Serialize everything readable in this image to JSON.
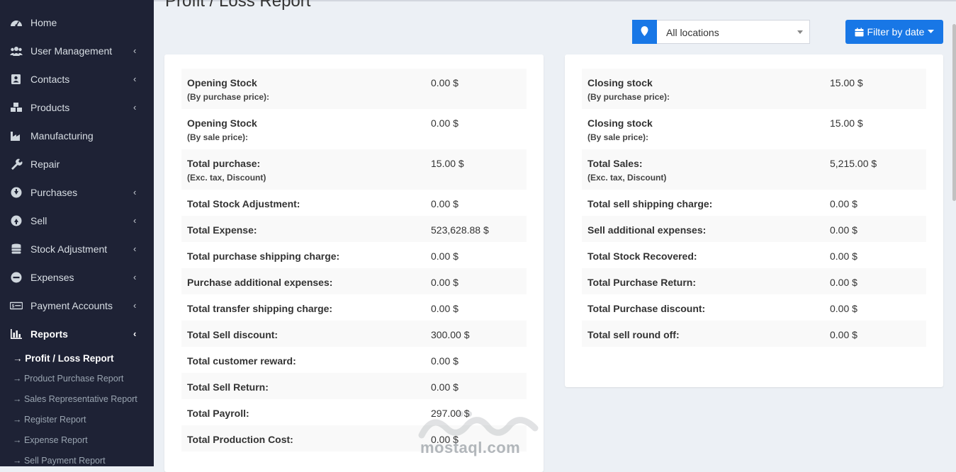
{
  "sidebar": {
    "items": [
      {
        "label": "Home",
        "icon": "dashboard-icon",
        "chevron": ""
      },
      {
        "label": "User Management",
        "icon": "users-icon",
        "chevron": "‹"
      },
      {
        "label": "Contacts",
        "icon": "address-book-icon",
        "chevron": "‹"
      },
      {
        "label": "Products",
        "icon": "cubes-icon",
        "chevron": "‹"
      },
      {
        "label": "Manufacturing",
        "icon": "industry-icon",
        "chevron": ""
      },
      {
        "label": "Repair",
        "icon": "wrench-icon",
        "chevron": ""
      },
      {
        "label": "Purchases",
        "icon": "arrow-circle-down-icon",
        "chevron": "‹"
      },
      {
        "label": "Sell",
        "icon": "arrow-circle-up-icon",
        "chevron": "‹"
      },
      {
        "label": "Stock Adjustment",
        "icon": "database-icon",
        "chevron": "‹"
      },
      {
        "label": "Expenses",
        "icon": "minus-circle-icon",
        "chevron": "‹"
      },
      {
        "label": "Payment Accounts",
        "icon": "money-icon",
        "chevron": "‹"
      },
      {
        "label": "Reports",
        "icon": "bar-chart-icon",
        "chevron": "‹"
      }
    ],
    "report_links": [
      "→ Profit / Loss Report",
      "→ Product Purchase Report",
      "→ Sales Representative Report",
      "→ Register Report",
      "→ Expense Report",
      "→ Sell Payment Report"
    ]
  },
  "header": {
    "title": "Profit / Loss Report",
    "location_select": "All locations",
    "filter_button": "Filter by date"
  },
  "left_panel": [
    {
      "label": "Opening Stock",
      "sub": "(By purchase price):",
      "value": "0.00 $"
    },
    {
      "label": "Opening Stock",
      "sub": "(By sale price):",
      "value": "0.00 $"
    },
    {
      "label": "Total purchase:",
      "sub": "(Exc. tax, Discount)",
      "value": "15.00 $"
    },
    {
      "label": "Total Stock Adjustment:",
      "sub": "",
      "value": "0.00 $"
    },
    {
      "label": "Total Expense:",
      "sub": "",
      "value": "523,628.88 $"
    },
    {
      "label": "Total purchase shipping charge:",
      "sub": "",
      "value": "0.00 $"
    },
    {
      "label": "Purchase additional expenses:",
      "sub": "",
      "value": "0.00 $"
    },
    {
      "label": "Total transfer shipping charge:",
      "sub": "",
      "value": "0.00 $"
    },
    {
      "label": "Total Sell discount:",
      "sub": "",
      "value": "300.00 $"
    },
    {
      "label": "Total customer reward:",
      "sub": "",
      "value": "0.00 $"
    },
    {
      "label": "Total Sell Return:",
      "sub": "",
      "value": "0.00 $"
    },
    {
      "label": "Total Payroll:",
      "sub": "",
      "value": "297.00 $"
    },
    {
      "label": "Total Production Cost:",
      "sub": "",
      "value": "0.00 $"
    }
  ],
  "right_panel": [
    {
      "label": "Closing stock",
      "sub": "(By purchase price):",
      "value": "15.00 $"
    },
    {
      "label": "Closing stock",
      "sub": "(By sale price):",
      "value": "15.00 $"
    },
    {
      "label": "Total Sales:",
      "sub": "(Exc. tax, Discount)",
      "value": "5,215.00 $"
    },
    {
      "label": "Total sell shipping charge:",
      "sub": "",
      "value": "0.00 $"
    },
    {
      "label": "Sell additional expenses:",
      "sub": "",
      "value": "0.00 $"
    },
    {
      "label": "Total Stock Recovered:",
      "sub": "",
      "value": "0.00 $"
    },
    {
      "label": "Total Purchase Return:",
      "sub": "",
      "value": "0.00 $"
    },
    {
      "label": "Total Purchase discount:",
      "sub": "",
      "value": "0.00 $"
    },
    {
      "label": "Total sell round off:",
      "sub": "",
      "value": "0.00 $"
    }
  ],
  "watermark": {
    "text": "mostaql.com"
  },
  "colors": {
    "sidebar_bg": "#1e2235",
    "accent": "#1877e6",
    "page_bg": "#ecf0f5"
  }
}
